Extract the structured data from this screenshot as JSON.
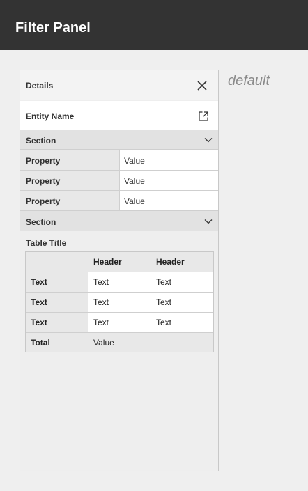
{
  "app": {
    "title": "Filter Panel"
  },
  "state_label": "default",
  "panel": {
    "title": "Details",
    "close_icon": "close-icon",
    "entity_name": "Entity Name",
    "open_icon": "external-link-icon",
    "sections": [
      {
        "label": "Section",
        "chevron_icon": "chevron-down-icon",
        "properties": [
          {
            "key": "Property",
            "value": "Value"
          },
          {
            "key": "Property",
            "value": "Value"
          },
          {
            "key": "Property",
            "value": "Value"
          }
        ]
      },
      {
        "label": "Section",
        "chevron_icon": "chevron-down-icon",
        "table": {
          "title": "Table Title",
          "headers": [
            "",
            "Header",
            "Header"
          ],
          "rows": [
            [
              "Text",
              "Text",
              "Text"
            ],
            [
              "Text",
              "Text",
              "Text"
            ],
            [
              "Text",
              "Text",
              "Text"
            ]
          ],
          "total": [
            "Total",
            "Value",
            ""
          ]
        }
      }
    ]
  },
  "colors": {
    "header_bg": "#333333",
    "panel_header_bg": "#f3f3f3",
    "section_bg": "#e2e2e2",
    "key_bg": "#e8e8e8",
    "border": "#cfcfcf",
    "state_label": "#8a8a8a"
  }
}
